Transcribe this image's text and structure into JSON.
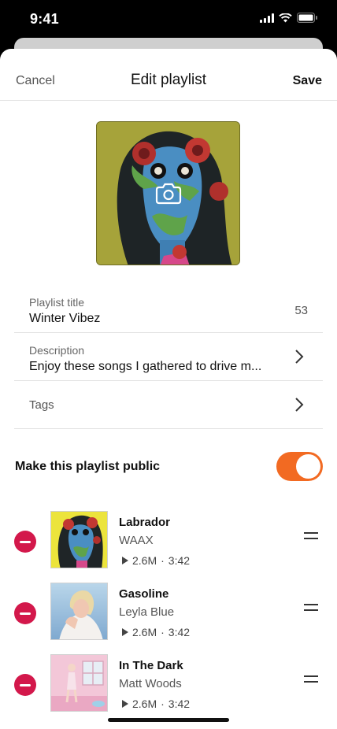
{
  "status_bar": {
    "time": "9:41"
  },
  "nav": {
    "cancel": "Cancel",
    "title": "Edit playlist",
    "save": "Save"
  },
  "cover": {
    "icon": "camera-icon"
  },
  "form": {
    "title_label": "Playlist title",
    "title_value": "Winter Vibez",
    "title_count": "53",
    "description_label": "Description",
    "description_value": "Enjoy these songs I gathered to drive m...",
    "tags_label": "Tags"
  },
  "public": {
    "label": "Make this playlist public",
    "enabled": true
  },
  "tracks": [
    {
      "title": "Labrador",
      "artist": "WAAX",
      "plays": "2.6M",
      "sep": "·",
      "duration": "3:42"
    },
    {
      "title": "Gasoline",
      "artist": "Leyla Blue",
      "plays": "2.6M",
      "sep": "·",
      "duration": "3:42"
    },
    {
      "title": "In The Dark",
      "artist": "Matt Woods",
      "plays": "2.6M",
      "sep": "·",
      "duration": "3:42"
    }
  ],
  "colors": {
    "accent": "#f26a22",
    "remove": "#d3184b"
  }
}
